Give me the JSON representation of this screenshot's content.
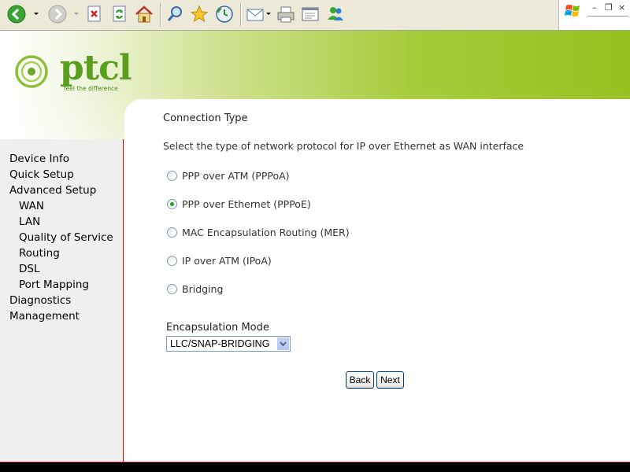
{
  "browser": {
    "toolbar_icons": [
      "back-icon",
      "forward-icon",
      "stop-icon",
      "refresh-icon",
      "home-icon",
      "search-icon",
      "favorites-icon",
      "history-icon",
      "mail-icon",
      "print-icon",
      "edit-icon",
      "messenger-icon"
    ],
    "window_controls": [
      "minimize",
      "restore",
      "close"
    ]
  },
  "brand": {
    "logo_text": "ptcl",
    "tagline": "feel the difference",
    "color": "#5a9e1e"
  },
  "sidebar": {
    "items": [
      {
        "label": "Device Info",
        "sub": false
      },
      {
        "label": "Quick Setup",
        "sub": false
      },
      {
        "label": "Advanced Setup",
        "sub": false
      },
      {
        "label": "WAN",
        "sub": true
      },
      {
        "label": "LAN",
        "sub": true
      },
      {
        "label": "Quality of Service",
        "sub": true
      },
      {
        "label": "Routing",
        "sub": true
      },
      {
        "label": "DSL",
        "sub": true
      },
      {
        "label": "Port Mapping",
        "sub": true
      },
      {
        "label": "Diagnostics",
        "sub": false
      },
      {
        "label": "Management",
        "sub": false
      }
    ]
  },
  "main": {
    "title": "Connection Type",
    "description": "Select the type of network protocol for IP over Ethernet as WAN interface",
    "options": [
      {
        "label": "PPP over ATM (PPPoA)",
        "checked": false
      },
      {
        "label": "PPP over Ethernet (PPPoE)",
        "checked": true
      },
      {
        "label": "MAC Encapsulation Routing (MER)",
        "checked": false
      },
      {
        "label": "IP over ATM (IPoA)",
        "checked": false
      },
      {
        "label": "Bridging",
        "checked": false
      }
    ],
    "encapsulation_label": "Encapsulation Mode",
    "encapsulation_value": "LLC/SNAP-BRIDGING",
    "back_label": "Back",
    "next_label": "Next"
  },
  "colors": {
    "accent_red": "#d40000",
    "banner_green": "#95c11f",
    "radio_checked": "#21a121"
  }
}
